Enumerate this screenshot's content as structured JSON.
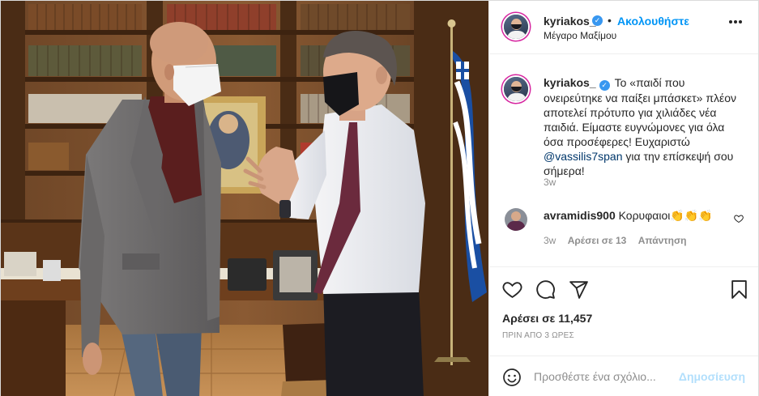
{
  "post": {
    "username": "kyriakos_",
    "verified_icon": "verified-badge-icon",
    "dot": "•",
    "follow_label": "Ακολουθήστε",
    "location": "Μέγαρο Μαξίμου",
    "caption": {
      "text_before_mention": "Το «παιδί που ονειρεύτηκε να παίξει μπάσκετ» πλέον αποτελεί πρότυπο για χιλιάδες νέα παιδιά. Είμαστε ευγνώμονες για όλα όσα προσέφερες! Ευχαριστώ ",
      "mention": "@vassilis7span",
      "text_after_mention": " για την επίσκεψή σου σήμερα!",
      "time": "3w"
    },
    "comments": [
      {
        "username": "avramidis900",
        "text": "Κορυφαιοι👏👏👏",
        "time": "3w",
        "likes_label": "Αρέσει σε 13",
        "reply_label": "Απάντηση"
      }
    ],
    "likes_label": "Αρέσει σε 11,457",
    "posted_ago": "ΠΡΙΝ ΑΠΟ 3 ΩΡΕΣ",
    "add_comment_placeholder": "Προσθέστε ένα σχόλιο...",
    "publish_label": "Δημοσίευση"
  },
  "colors": {
    "link_blue": "#0095f6",
    "verified_blue": "#3897f0",
    "mention": "#00376b",
    "muted": "#8e8e8e",
    "publish_disabled": "#b2dffc"
  }
}
